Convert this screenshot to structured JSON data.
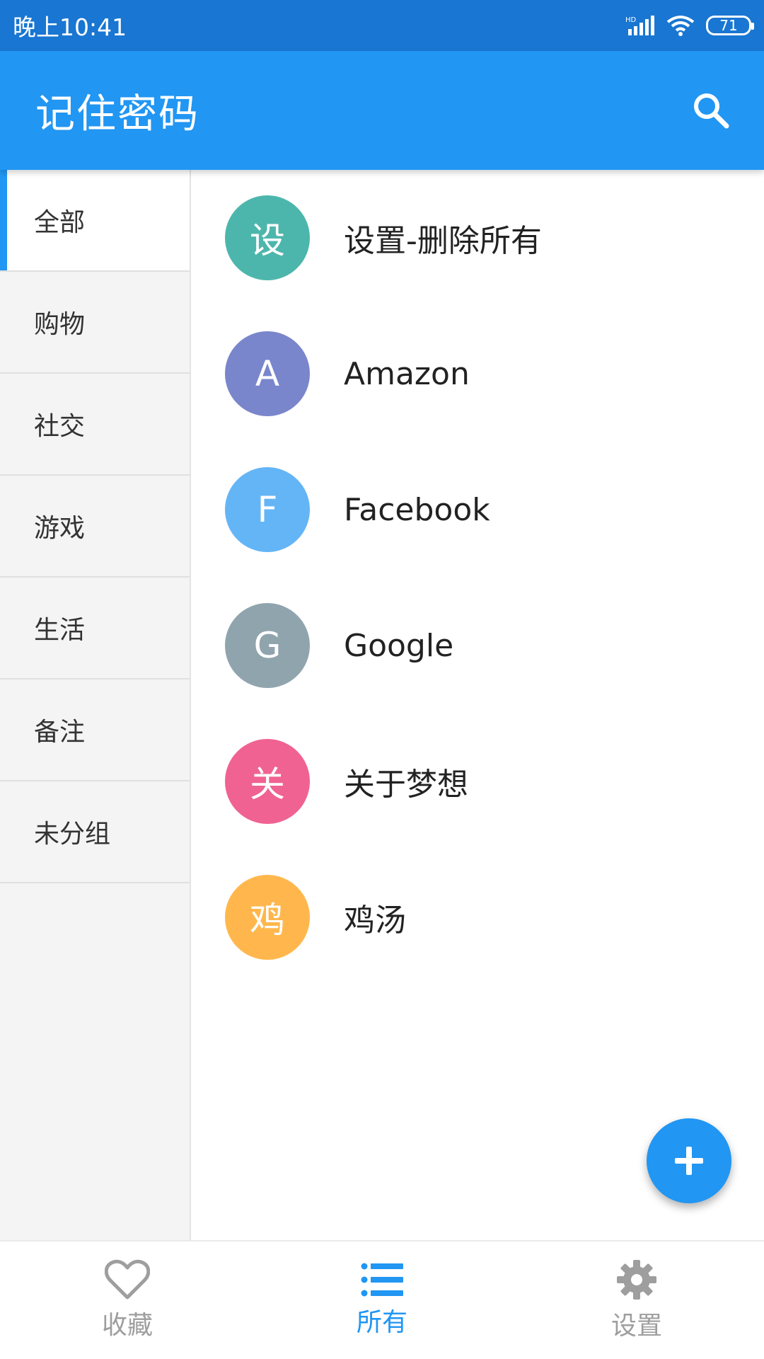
{
  "status_bar": {
    "time": "晚上10:41",
    "network_label": "HD",
    "battery": "71"
  },
  "app_bar": {
    "title": "记住密码"
  },
  "sidebar": {
    "items": [
      {
        "label": "全部",
        "active": true
      },
      {
        "label": "购物",
        "active": false
      },
      {
        "label": "社交",
        "active": false
      },
      {
        "label": "游戏",
        "active": false
      },
      {
        "label": "生活",
        "active": false
      },
      {
        "label": "备注",
        "active": false
      },
      {
        "label": "未分组",
        "active": false
      }
    ]
  },
  "entries": [
    {
      "initial": "设",
      "title": "设置-删除所有",
      "color": "#4DB6AC"
    },
    {
      "initial": "A",
      "title": "Amazon",
      "color": "#7986CB"
    },
    {
      "initial": "F",
      "title": "Facebook",
      "color": "#64B5F6"
    },
    {
      "initial": "G",
      "title": "Google",
      "color": "#90A4AE"
    },
    {
      "initial": "关",
      "title": "关于梦想",
      "color": "#F06292"
    },
    {
      "initial": "鸡",
      "title": "鸡汤",
      "color": "#FFB74D"
    }
  ],
  "bottom_nav": {
    "items": [
      {
        "label": "收藏",
        "icon": "heart-icon",
        "active": false
      },
      {
        "label": "所有",
        "icon": "list-icon",
        "active": true
      },
      {
        "label": "设置",
        "icon": "gear-icon",
        "active": false
      }
    ]
  },
  "colors": {
    "primary": "#2196F3",
    "status_bar": "#1976D2"
  }
}
